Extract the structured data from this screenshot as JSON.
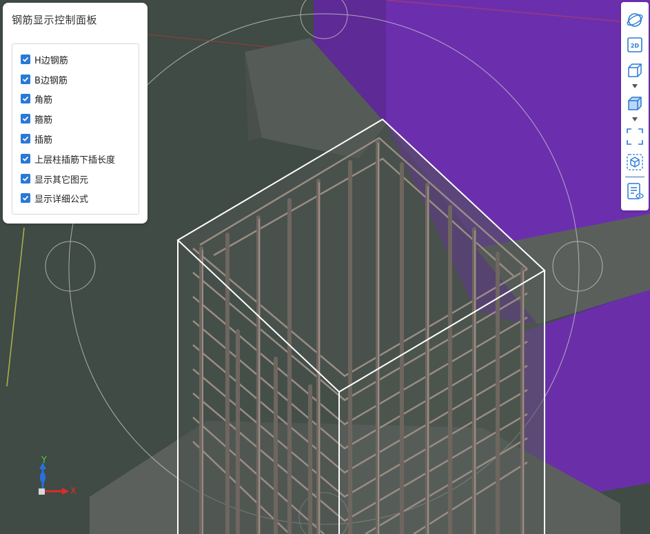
{
  "panel": {
    "title": "钢筋显示控制面板",
    "options": [
      {
        "label": "H边钢筋",
        "checked": true
      },
      {
        "label": "B边钢筋",
        "checked": true
      },
      {
        "label": "角筋",
        "checked": true
      },
      {
        "label": "箍筋",
        "checked": true
      },
      {
        "label": "插筋",
        "checked": true
      },
      {
        "label": "上层柱插筋下插长度",
        "checked": true
      },
      {
        "label": "显示其它图元",
        "checked": true
      },
      {
        "label": "显示详细公式",
        "checked": true
      }
    ]
  },
  "toolbar": {
    "view_2d_label": "2D",
    "tools": [
      "orbit-icon",
      "view-2d-icon",
      "wireframe-cube-icon",
      "solid-cube-icon",
      "fit-extent-icon",
      "isolate-icon",
      "formula-view-icon"
    ]
  },
  "axis": {
    "x_label": "X",
    "y_label": "Y"
  },
  "colors": {
    "background": "#3e4a43",
    "wall": "#6a2fa8",
    "accent": "#2979d6",
    "rebar": "#9a8d84"
  }
}
